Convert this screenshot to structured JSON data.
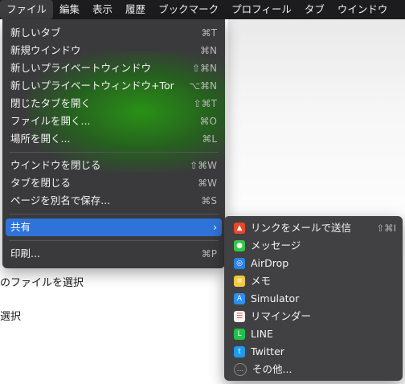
{
  "menubar": {
    "items": [
      "ファイル",
      "編集",
      "表示",
      "履歴",
      "ブックマーク",
      "プロフィール",
      "タブ",
      "ウインドウ"
    ]
  },
  "background": {
    "line1": "のファイルを選択",
    "line2": "選択"
  },
  "file_menu": {
    "group1": [
      {
        "label": "新しいタブ",
        "shortcut": "⌘T"
      },
      {
        "label": "新規ウインドウ",
        "shortcut": "⌘N"
      },
      {
        "label": "新しいプライベートウィンドウ",
        "shortcut": "⇧⌘N"
      },
      {
        "label": "新しいプライベートウィンドウ+Tor",
        "shortcut": "⌥⌘N"
      },
      {
        "label": "閉じたタブを開く",
        "shortcut": "⇧⌘T"
      },
      {
        "label": "ファイルを開く...",
        "shortcut": "⌘O"
      },
      {
        "label": "場所を開く...",
        "shortcut": "⌘L"
      }
    ],
    "group2": [
      {
        "label": "ウインドウを閉じる",
        "shortcut": "⇧⌘W"
      },
      {
        "label": "タブを閉じる",
        "shortcut": "⌘W"
      },
      {
        "label": "ページを別名で保存...",
        "shortcut": "⌘S"
      }
    ],
    "share": {
      "label": "共有",
      "chevron": "›"
    },
    "print": {
      "label": "印刷...",
      "shortcut": "⌘P"
    }
  },
  "share_menu": {
    "items": [
      {
        "label": "リンクをメールで送信",
        "shortcut": "⇧⌘I",
        "icon": "brave-icon",
        "color": "#e8482a"
      },
      {
        "label": "メッセージ",
        "shortcut": "",
        "icon": "messages-icon",
        "color": "#33c64a"
      },
      {
        "label": "AirDrop",
        "shortcut": "",
        "icon": "airdrop-icon",
        "color": "#2a83e6"
      },
      {
        "label": "メモ",
        "shortcut": "",
        "icon": "notes-icon",
        "color": "#f3c843"
      },
      {
        "label": "Simulator",
        "shortcut": "",
        "icon": "simulator-icon",
        "color": "#2d8ff0"
      },
      {
        "label": "リマインダー",
        "shortcut": "",
        "icon": "reminders-icon",
        "color": "#f2f2f2"
      },
      {
        "label": "LINE",
        "shortcut": "",
        "icon": "line-icon",
        "color": "#1fc24a"
      },
      {
        "label": "Twitter",
        "shortcut": "",
        "icon": "twitter-icon",
        "color": "#1d9bf0"
      },
      {
        "label": "その他...",
        "shortcut": "",
        "icon": "more-icon",
        "color": "#6a6a6c"
      }
    ]
  }
}
